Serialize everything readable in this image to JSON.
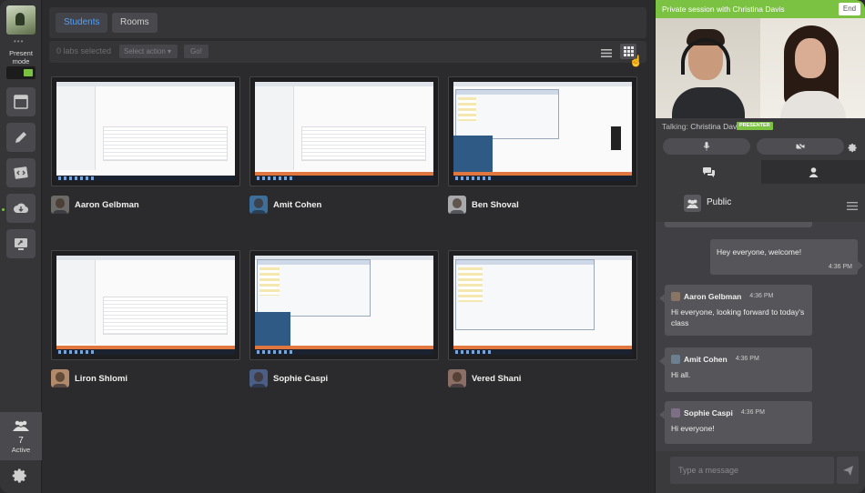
{
  "rail": {
    "present_label": "Present mode",
    "active_count": "7",
    "active_label": "Active"
  },
  "main": {
    "tabs": [
      {
        "label": "Students"
      },
      {
        "label": "Rooms"
      }
    ],
    "toolbar": {
      "selected_text": "0 labs selected",
      "action_placeholder": "Select action ▾",
      "go_label": "Go!"
    },
    "students": [
      {
        "name": "Aaron Gelbman"
      },
      {
        "name": "Amit Cohen"
      },
      {
        "name": "Ben Shoval"
      },
      {
        "name": "Liron Shlomi"
      },
      {
        "name": "Sophie Caspi"
      },
      {
        "name": "Vered Shani"
      }
    ]
  },
  "session": {
    "title": "Private session with Christina Davis",
    "end_label": "End",
    "talking_label": "Talking:",
    "talking_name": "Christina Davis",
    "presenter_badge": "PRESENTER"
  },
  "chat": {
    "channel": "Public",
    "messages": [
      {
        "text": "Hey everyone, welcome!",
        "time": "4:36 PM"
      },
      {
        "author": "Aaron Gelbman",
        "time": "4:36 PM",
        "text": "Hi everyone, looking forward to today's class"
      },
      {
        "author": "Amit Cohen",
        "time": "4:36 PM",
        "text": "Hi all."
      },
      {
        "author": "Sophie Caspi",
        "time": "4:36 PM",
        "text": "Hi everyone!"
      }
    ],
    "input_placeholder": "Type a message"
  },
  "colors": {
    "accent_green": "#7bc142",
    "accent_blue": "#4aa3ff",
    "background": "#2b2b2d"
  }
}
